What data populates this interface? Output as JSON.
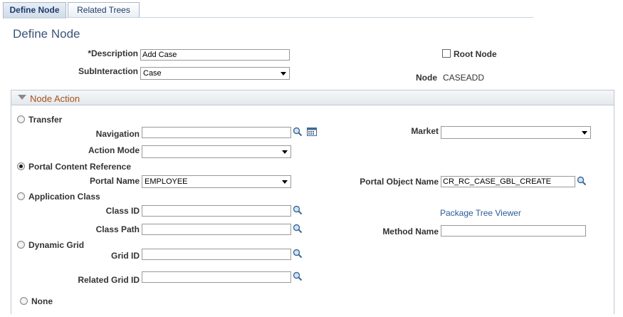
{
  "tabs": [
    {
      "label": "Define Node",
      "active": true
    },
    {
      "label": "Related Trees",
      "active": false
    }
  ],
  "page_title": "Define Node",
  "description": {
    "label": "*Description",
    "value": "Add Case"
  },
  "subinteraction": {
    "label": "SubInteraction",
    "value": "Case"
  },
  "root_node": {
    "label": "Root Node",
    "checked": false
  },
  "node": {
    "label": "Node",
    "value": "CASEADD"
  },
  "section": {
    "title": "Node Action"
  },
  "transfer": {
    "label": "Transfer",
    "checked": false
  },
  "navigation": {
    "label": "Navigation",
    "value": ""
  },
  "market": {
    "label": "Market",
    "value": ""
  },
  "action_mode": {
    "label": "Action Mode",
    "value": ""
  },
  "portal_content_reference": {
    "label": "Portal Content Reference",
    "checked": true
  },
  "portal_name": {
    "label": "Portal Name",
    "value": "EMPLOYEE"
  },
  "portal_object_name": {
    "label": "Portal Object Name",
    "value": "CR_RC_CASE_GBL_CREATE"
  },
  "application_class": {
    "label": "Application Class",
    "checked": false
  },
  "class_id": {
    "label": "Class ID",
    "value": ""
  },
  "package_tree_viewer": {
    "label": "Package Tree Viewer"
  },
  "class_path": {
    "label": "Class Path",
    "value": ""
  },
  "method_name": {
    "label": "Method Name",
    "value": ""
  },
  "dynamic_grid": {
    "label": "Dynamic Grid",
    "checked": false
  },
  "grid_id": {
    "label": "Grid ID",
    "value": ""
  },
  "related_grid_id": {
    "label": "Related Grid ID",
    "value": ""
  },
  "none": {
    "label": "None",
    "checked": false
  },
  "icons": {
    "lookup": "magnifier-icon",
    "calendar": "prompt-list-icon",
    "collapse": "collapse-triangle-icon"
  },
  "colors": {
    "link": "#2a5b96",
    "section_title": "#a8541c",
    "page_title": "#3b5578"
  }
}
